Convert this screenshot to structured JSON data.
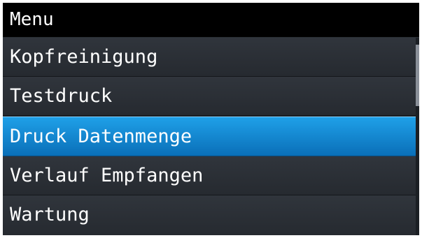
{
  "header": {
    "title": "Menu"
  },
  "menu": {
    "items": [
      {
        "label": "Kopfreinigung",
        "selected": false
      },
      {
        "label": "Testdruck",
        "selected": false
      },
      {
        "label": "Druck Datenmenge",
        "selected": true
      },
      {
        "label": "Verlauf Empfangen",
        "selected": false
      },
      {
        "label": "Wartung",
        "selected": false
      }
    ]
  },
  "colors": {
    "title_background": "#000000",
    "list_background": "#2a2f35",
    "selected_background": "#1a8ad6",
    "text": "#ffffff"
  }
}
